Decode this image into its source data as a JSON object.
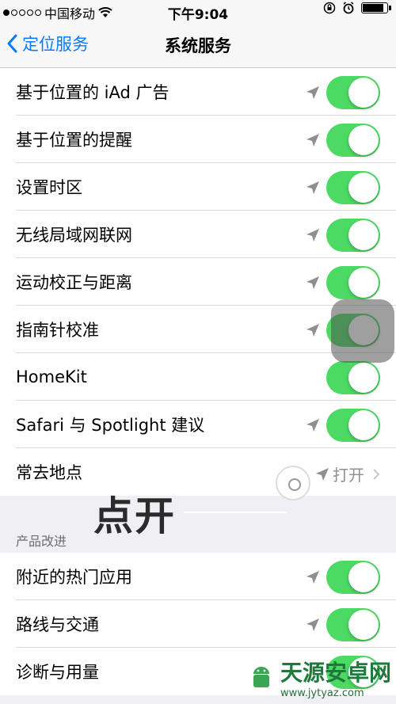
{
  "status_bar": {
    "carrier": "中国移动",
    "time": "下午9:04"
  },
  "nav": {
    "back_label": "定位服务",
    "title": "系统服务"
  },
  "group1": [
    {
      "label": "基于位置的 iAd 广告",
      "toggle": "on"
    },
    {
      "label": "基于位置的提醒",
      "toggle": "on"
    },
    {
      "label": "设置时区",
      "toggle": "on"
    },
    {
      "label": "无线局域网联网",
      "toggle": "on"
    },
    {
      "label": "运动校正与距离",
      "toggle": "on"
    },
    {
      "label": "指南针校准",
      "toggle": "on"
    },
    {
      "label": "HomeKit",
      "toggle": "on"
    },
    {
      "label": "Safari 与 Spotlight 建议",
      "toggle": "on"
    },
    {
      "label": "常去地点",
      "detail": "打开"
    }
  ],
  "section_header": "产品改进",
  "group2": [
    {
      "label": "附近的热门应用",
      "toggle": "on"
    },
    {
      "label": "路线与交通",
      "toggle": "on"
    },
    {
      "label": "诊断与用量",
      "toggle": "on"
    }
  ],
  "annotation": "点开",
  "watermark": {
    "name": "天源安卓网",
    "url": "www.jytyaz.com"
  },
  "colors": {
    "toggle_on": "#4cd964",
    "accent": "#0a7aff"
  }
}
